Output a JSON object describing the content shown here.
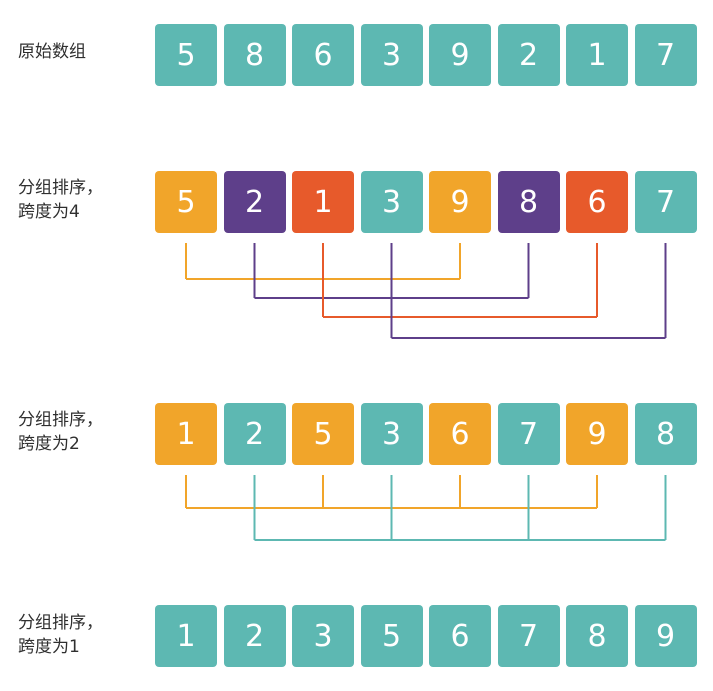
{
  "colors": {
    "teal": "#5db8b2",
    "orange": "#f1a52a",
    "purple": "#5e3f8a",
    "red": "#e75a2b"
  },
  "rows": [
    {
      "label_lines": [
        "原始数组"
      ],
      "values": [
        "5",
        "8",
        "6",
        "3",
        "9",
        "2",
        "1",
        "7"
      ],
      "colors": [
        "teal",
        "teal",
        "teal",
        "teal",
        "teal",
        "teal",
        "teal",
        "teal"
      ],
      "groups": []
    },
    {
      "label_lines": [
        "分组排序，",
        "跨度为4"
      ],
      "values": [
        "5",
        "2",
        "1",
        "3",
        "9",
        "8",
        "6",
        "7"
      ],
      "colors": [
        "orange",
        "purple",
        "red",
        "teal",
        "orange",
        "purple",
        "red",
        "teal"
      ],
      "groups": [
        {
          "color": "orange",
          "indices": [
            0,
            4
          ]
        },
        {
          "color": "purple",
          "indices": [
            1,
            5
          ]
        },
        {
          "color": "red",
          "indices": [
            2,
            6
          ]
        },
        {
          "color": "purple",
          "indices": [
            3,
            7
          ]
        }
      ]
    },
    {
      "label_lines": [
        "分组排序，",
        "跨度为2"
      ],
      "values": [
        "1",
        "2",
        "5",
        "3",
        "6",
        "7",
        "9",
        "8"
      ],
      "colors": [
        "orange",
        "teal",
        "orange",
        "teal",
        "orange",
        "teal",
        "orange",
        "teal"
      ],
      "groups": [
        {
          "color": "orange",
          "indices": [
            0,
            2,
            4,
            6
          ]
        },
        {
          "color": "teal",
          "indices": [
            1,
            3,
            5,
            7
          ]
        }
      ]
    },
    {
      "label_lines": [
        "分组排序，",
        "跨度为1"
      ],
      "values": [
        "1",
        "2",
        "3",
        "5",
        "6",
        "7",
        "8",
        "9"
      ],
      "colors": [
        "teal",
        "teal",
        "teal",
        "teal",
        "teal",
        "teal",
        "teal",
        "teal"
      ],
      "groups": []
    }
  ]
}
